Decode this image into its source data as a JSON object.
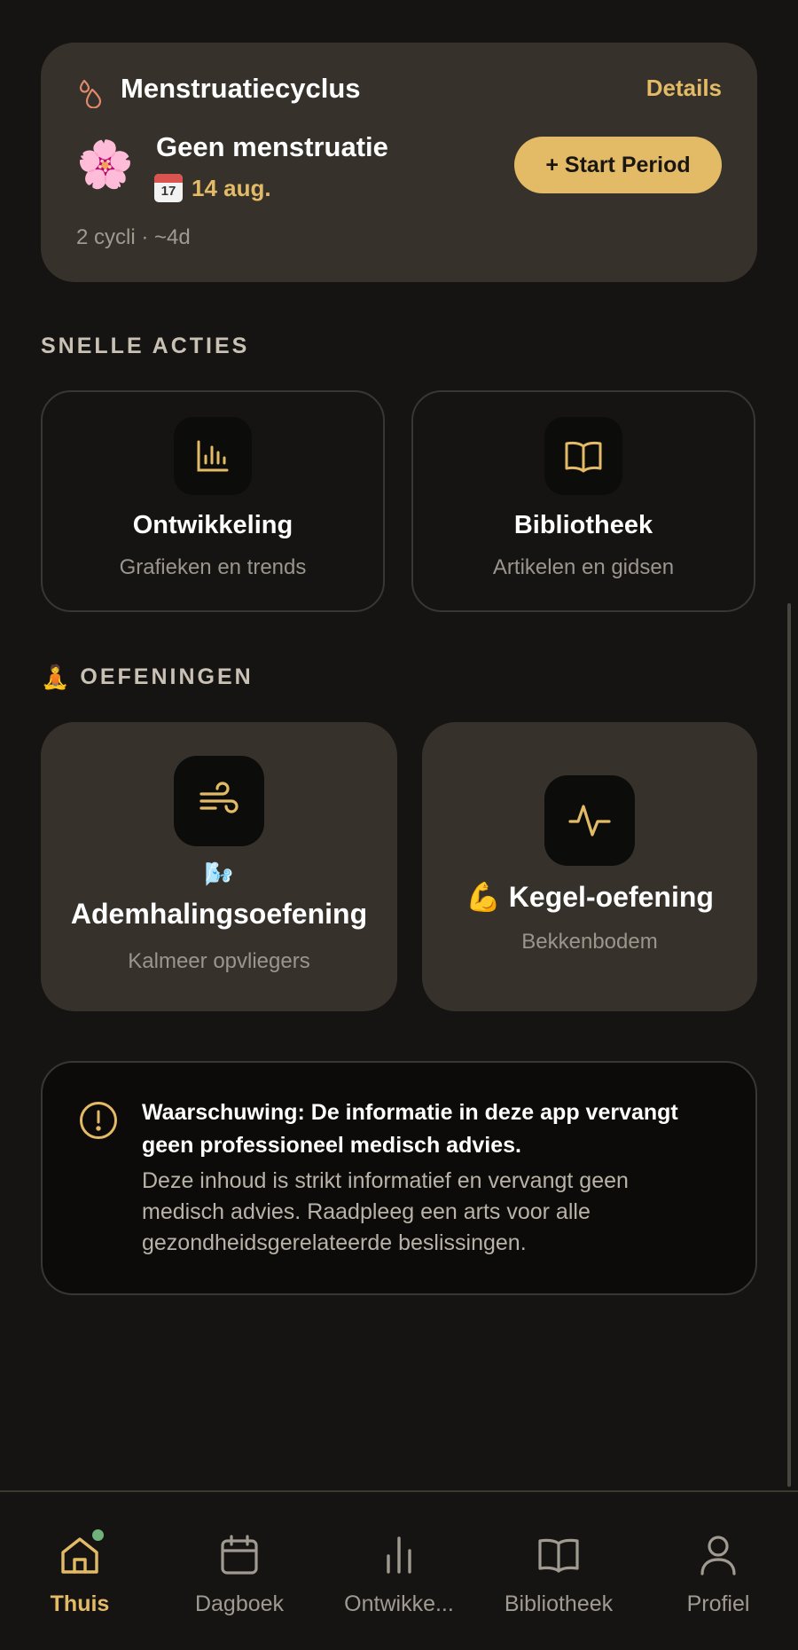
{
  "colors": {
    "accent": "#e3bb66",
    "card": "#36322b",
    "background": "#151413",
    "notification_dot": "#6fb37a"
  },
  "cycle_card": {
    "header_icon": "drops-icon",
    "title": "Menstruatiecyclus",
    "details_label": "Details",
    "status_emoji": "🌸",
    "status_title": "Geen menstruatie",
    "date_icon": "calendar-emoji-icon",
    "date": "14 aug.",
    "start_button_label": "+ Start Period",
    "meta": "2 cycli · ~4d"
  },
  "quick_actions": {
    "section_label": "SNELLE ACTIES",
    "items": [
      {
        "icon": "bar-chart-icon",
        "title": "Ontwikkeling",
        "subtitle": "Grafieken en trends"
      },
      {
        "icon": "book-icon",
        "title": "Bibliotheek",
        "subtitle": "Artikelen en gidsen"
      }
    ]
  },
  "exercises": {
    "section_emoji": "🧘",
    "section_label": "OEFENINGEN",
    "items": [
      {
        "icon": "wind-icon",
        "emoji": "🌬️",
        "title": "Ademhalingsoefening",
        "subtitle": "Kalmeer opvliegers"
      },
      {
        "icon": "pulse-icon",
        "emoji": "💪",
        "title": "Kegel-oefening",
        "subtitle": "Bekkenbodem"
      }
    ]
  },
  "warning": {
    "icon": "alert-circle-icon",
    "title": "Waarschuwing: De informatie in deze app vervangt geen professioneel medisch advies.",
    "body": "Deze inhoud is strikt informatief en vervangt geen medisch advies. Raadpleeg een arts voor alle gezondheidsgerelateerde beslissingen."
  },
  "bottom_nav": [
    {
      "icon": "home-icon",
      "label": "Thuis",
      "active": true
    },
    {
      "icon": "calendar-icon",
      "label": "Dagboek",
      "active": false
    },
    {
      "icon": "bar-chart-icon",
      "label": "Ontwikke...",
      "active": false
    },
    {
      "icon": "book-icon",
      "label": "Bibliotheek",
      "active": false
    },
    {
      "icon": "user-icon",
      "label": "Profiel",
      "active": false
    }
  ]
}
